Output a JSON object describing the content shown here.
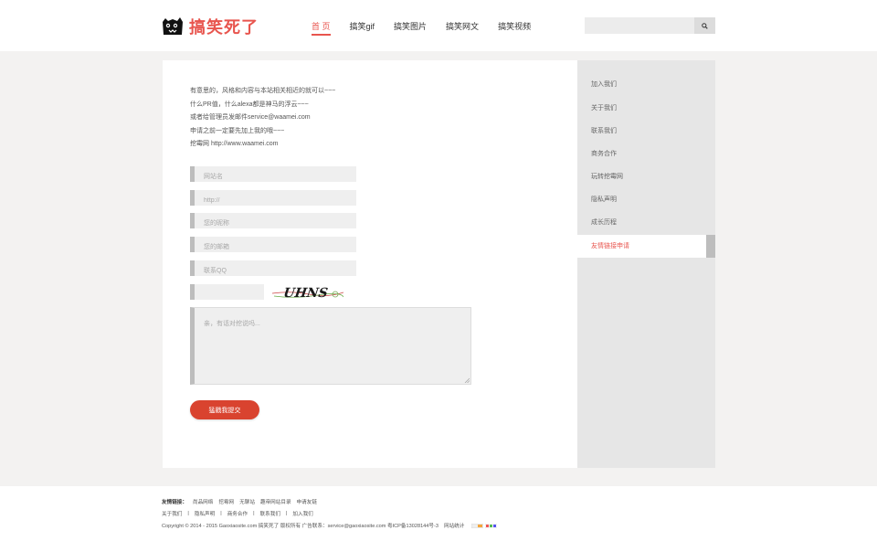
{
  "header": {
    "logo_text": "搞笑死了",
    "nav": [
      {
        "label": "首 页",
        "active": true
      },
      {
        "label": "搞笑gif",
        "active": false
      },
      {
        "label": "搞笑图片",
        "active": false
      },
      {
        "label": "搞笑网文",
        "active": false
      },
      {
        "label": "搞笑视频",
        "active": false
      }
    ],
    "search_placeholder": "",
    "search_icon": "search-icon"
  },
  "intro": [
    "有意思的，风格和内容与本站相关相近的就可以~~~",
    "什么PR值，什么alexa都是神马的浮云~~~",
    "或者给管理员发邮件service@waamei.com",
    "申请之前一定要先加上我的哦~~~",
    "挖霉网 http://www.waamei.com"
  ],
  "form": {
    "site_name_placeholder": "网站名",
    "url_placeholder": "http://",
    "nickname_placeholder": "您的昵称",
    "email_placeholder": "您的邮箱",
    "qq_placeholder": "联系QQ",
    "captcha_value": "",
    "captcha_text": "UHNS",
    "message_placeholder": "亲，有话对挖说吗...",
    "submit_label": "猛戳我提交"
  },
  "sidebar": {
    "items": [
      {
        "label": "加入我们",
        "active": false
      },
      {
        "label": "关于我们",
        "active": false
      },
      {
        "label": "联系我们",
        "active": false
      },
      {
        "label": "商务合作",
        "active": false
      },
      {
        "label": "玩转挖霉网",
        "active": false
      },
      {
        "label": "隐私声明",
        "active": false
      },
      {
        "label": "成长历程",
        "active": false
      },
      {
        "label": "友情链接申请",
        "active": true
      }
    ]
  },
  "footer": {
    "links_label": "友情链接：",
    "friend_links": [
      "尚品网络",
      "挖霉网",
      "无聊站",
      "趣帝网站目录",
      "申请友链"
    ],
    "bottom_links": [
      "关于我们",
      "隐私声明",
      "商务合作",
      "联系我们",
      "加入我们"
    ],
    "copyright": "Copyright © 2014 - 2015 Gaoxiaosite.com 搞笑死了 版权所有 广告联系：service@gaoxiaosite.com 粤ICP备13028144号-3",
    "stats_label": "网站统计"
  },
  "colors": {
    "accent": "#e8554e",
    "button": "#d9432f",
    "sidebar_bg": "#e6e6e6",
    "page_bg": "#f3f2f1"
  }
}
